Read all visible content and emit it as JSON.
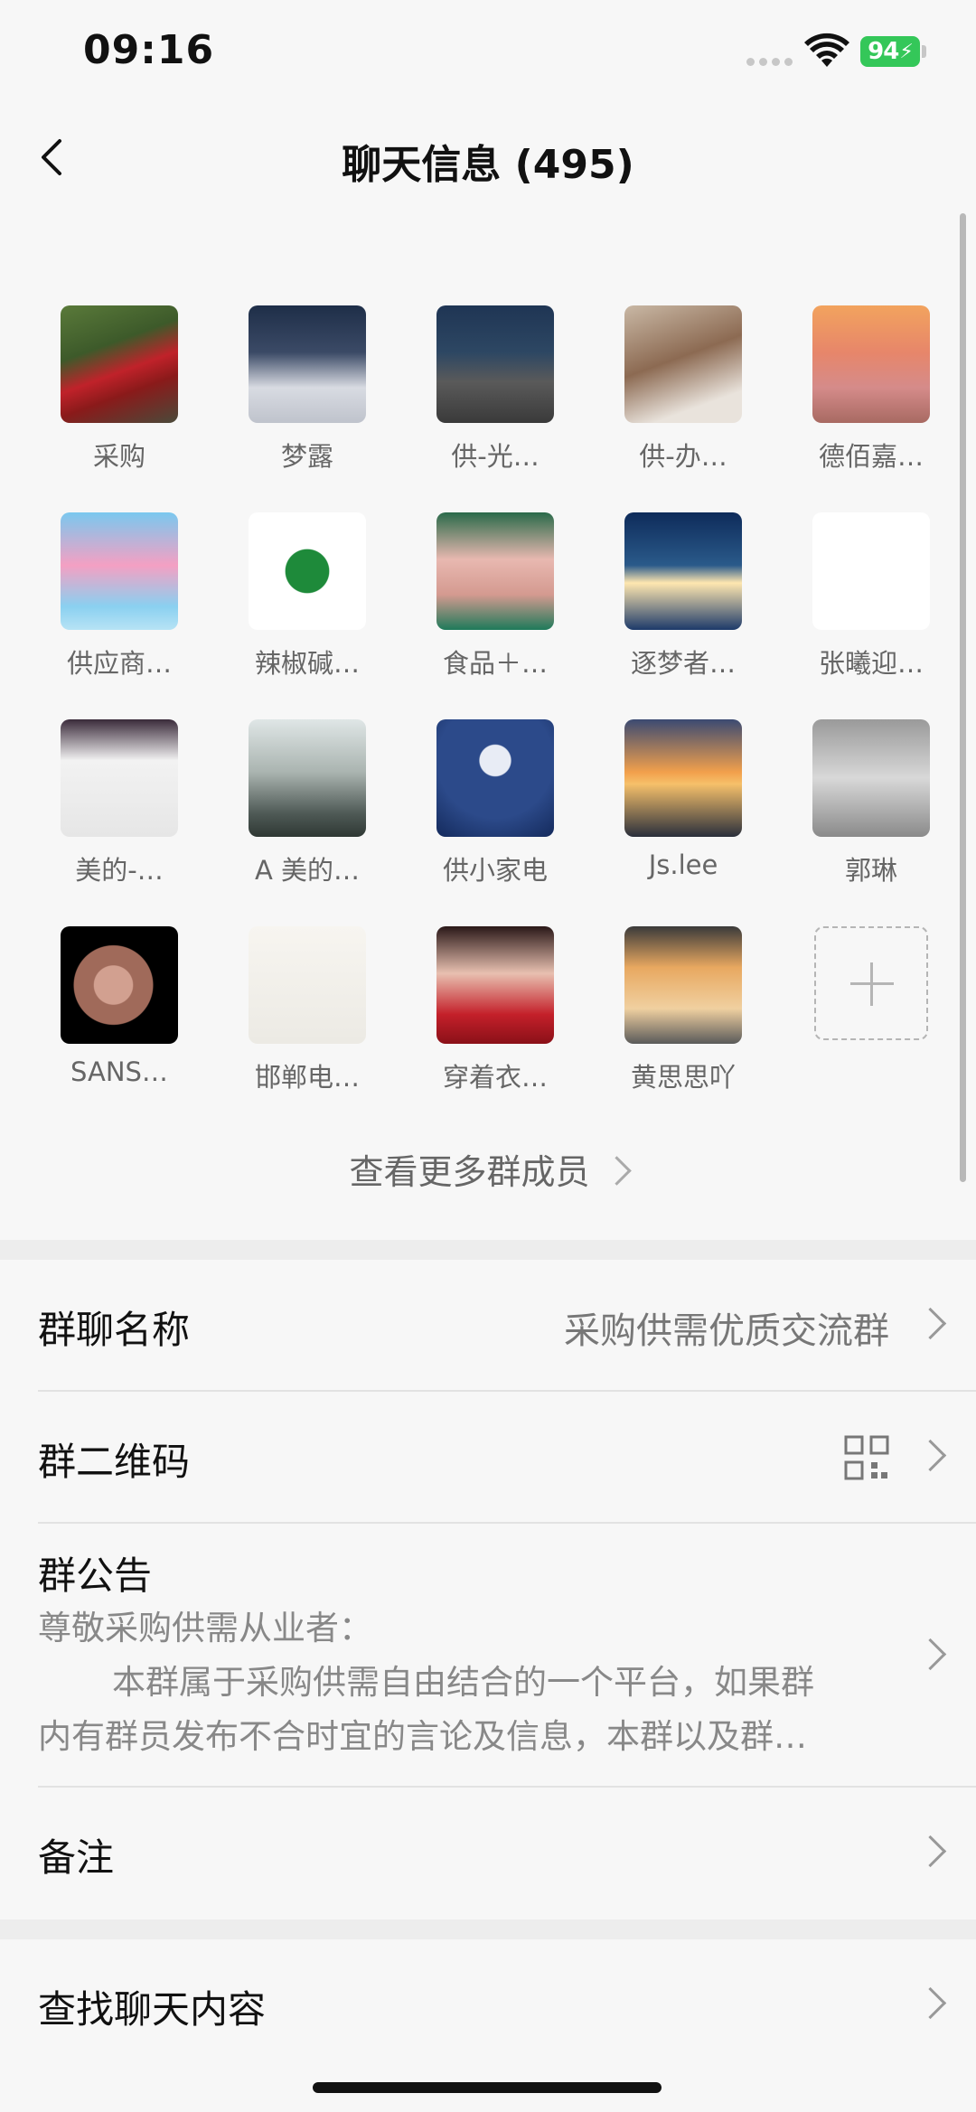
{
  "status_bar": {
    "time": "09:16",
    "battery": "94"
  },
  "nav": {
    "title": "聊天信息 (495)",
    "back_icon": "chevron-left-icon"
  },
  "members": [
    {
      "name": "采购",
      "bg": "linear-gradient(160deg,#5a7a3a 0%,#3d5a2a 35%,#c0222a 55%,#8a1a1a 70%,#4a4a3a 100%)"
    },
    {
      "name": "梦露",
      "bg": "linear-gradient(180deg,#1e2e48 0%,#3b4a66 40%,#d8dbe2 70%,#bfc3cc 100%)"
    },
    {
      "name": "供-光…",
      "bg": "linear-gradient(180deg,#1f3554 0%,#2d4763 40%,#5a5a5a 65%,#3a3a3a 100%)"
    },
    {
      "name": "供-办…",
      "bg": "linear-gradient(160deg,#c9b8a5 0%,#8c6a52 45%,#e9e3dc 80%)"
    },
    {
      "name": "德佰嘉…",
      "bg": "linear-gradient(180deg,#f2a35e 0%,#e7866a 40%,#d58b8a 70%,#a86a62 100%)"
    },
    {
      "name": "供应商…",
      "bg": "linear-gradient(180deg,#7ac8ef 0%,#f4a0c3 45%,#8ad0f0 80%,#b7e3f5 100%)"
    },
    {
      "name": "辣椒碱…",
      "bg": "radial-gradient(circle at 50% 50%,#1e8a3a 0 26%,#ffffff 27% 100%)"
    },
    {
      "name": "食品＋…",
      "bg": "linear-gradient(180deg,#2a6a4a 0%,#e8b8b0 40%,#d49a90 70%,#1f7a5a 100%)"
    },
    {
      "name": "逐梦者…",
      "bg": "linear-gradient(180deg,#0e2b5a 0%,#2a5a8a 45%,#ffe7b0 60%,#1d3a6a 100%)"
    },
    {
      "name": "张曦迎…",
      "bg": "linear-gradient(180deg,#ffffff 0%,#ffffff 100%)"
    },
    {
      "name": "美的-…",
      "bg": "linear-gradient(180deg,#3a2a3a 0%,#f2f2f2 35%,#e6e6e6 100%)"
    },
    {
      "name": "A 美的…",
      "bg": "linear-gradient(180deg,#dfe6e6 0%,#aab4b0 45%,#4f5a56 80%,#2f3834 100%)"
    },
    {
      "name": "供小家电",
      "bg": "radial-gradient(circle at 50% 35%,#e8ecf5 0 16%,#2c4a8a 17% 60%,#142a5c 100%)"
    },
    {
      "name": "Js.lee",
      "bg": "linear-gradient(180deg,#3b4a72 0%,#f2a04c 45%,#f6c06a 55%,#2a2f3c 100%)"
    },
    {
      "name": "郭琳",
      "bg": "linear-gradient(180deg,#9a9a9a 0%,#d8d8d8 50%,#8a8a8a 100%)"
    },
    {
      "name": "SANS…",
      "bg": "radial-gradient(circle at 45% 50%,#d2a090 0 22%,#a06a5a 23% 45%,#000 46% 100%)"
    },
    {
      "name": "邯郸电…",
      "bg": "linear-gradient(180deg,#f7f5f0 0%,#eceae4 100%)"
    },
    {
      "name": "穿着衣…",
      "bg": "linear-gradient(180deg,#2a1818 0%,#e8c0b0 40%,#c4202a 75%,#8a1018 100%)"
    },
    {
      "name": "黄思思吖",
      "bg": "linear-gradient(180deg,#3a3a3a 0%,#e8a860 35%,#f0d0a0 70%,#5a5a5a 100%)"
    }
  ],
  "add_member_icon": "plus-icon",
  "more_members_label": "查看更多群成员",
  "settings": {
    "group_name_label": "群聊名称",
    "group_name_value": "采购供需优质交流群",
    "qr_label": "群二维码",
    "notice_label": "群公告",
    "notice_line1": "尊敬采购供需从业者：",
    "notice_line2": "本群属于采购供需自由结合的一个平台，如果群",
    "notice_line3": "内有群员发布不合时宜的言论及信息，本群以及群…",
    "remark_label": "备注",
    "search_label": "查找聊天内容"
  }
}
